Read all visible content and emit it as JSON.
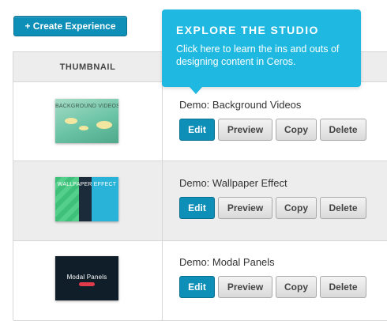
{
  "header": {
    "create_button_label": "+ Create Experience"
  },
  "table": {
    "columns": {
      "thumbnail": "THUMBNAIL"
    }
  },
  "tooltip": {
    "title": "EXPLORE THE STUDIO",
    "body": "Click here to learn the ins and outs of designing content in Ceros."
  },
  "experiences": [
    {
      "name": "Demo: Background Videos",
      "thumbnail_title": "BACKGROUND VIDEOS"
    },
    {
      "name": "Demo: Wallpaper Effect",
      "thumbnail_title": "WALLPAPER EFFECT"
    },
    {
      "name": "Demo: Modal Panels",
      "thumbnail_title": "Modal Panels"
    }
  ],
  "actions": {
    "edit": "Edit",
    "preview": "Preview",
    "copy": "Copy",
    "delete": "Delete"
  },
  "colors": {
    "accent": "#0d8fb7",
    "tooltip": "#1eb8e0",
    "row_alt": "#ededed"
  }
}
